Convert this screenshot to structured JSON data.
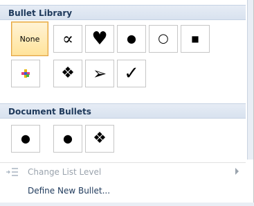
{
  "library": {
    "header": "Bullet Library",
    "tiles": [
      {
        "label": "None",
        "icon": "none-text"
      },
      {
        "label": "∝",
        "icon": "proportional-icon"
      },
      {
        "label": "♥",
        "icon": "heart-icon"
      },
      {
        "label": "●",
        "icon": "filled-circle-icon"
      },
      {
        "label": "○",
        "icon": "hollow-circle-icon"
      },
      {
        "label": "■",
        "icon": "filled-square-icon"
      },
      {
        "label": "",
        "icon": "color-cross-icon"
      },
      {
        "label": "❖",
        "icon": "diamond-cluster-icon"
      },
      {
        "label": "➢",
        "icon": "arrowhead-icon"
      },
      {
        "label": "✓",
        "icon": "checkmark-icon"
      }
    ]
  },
  "document": {
    "header": "Document Bullets",
    "tiles": [
      {
        "label": "●",
        "icon": "filled-circle-icon"
      },
      {
        "label": "●",
        "icon": "filled-circle-icon"
      },
      {
        "label": "❖",
        "icon": "diamond-cluster-icon"
      }
    ]
  },
  "menu": {
    "change_level": "Change List Level",
    "define_new": "Define New Bullet..."
  }
}
